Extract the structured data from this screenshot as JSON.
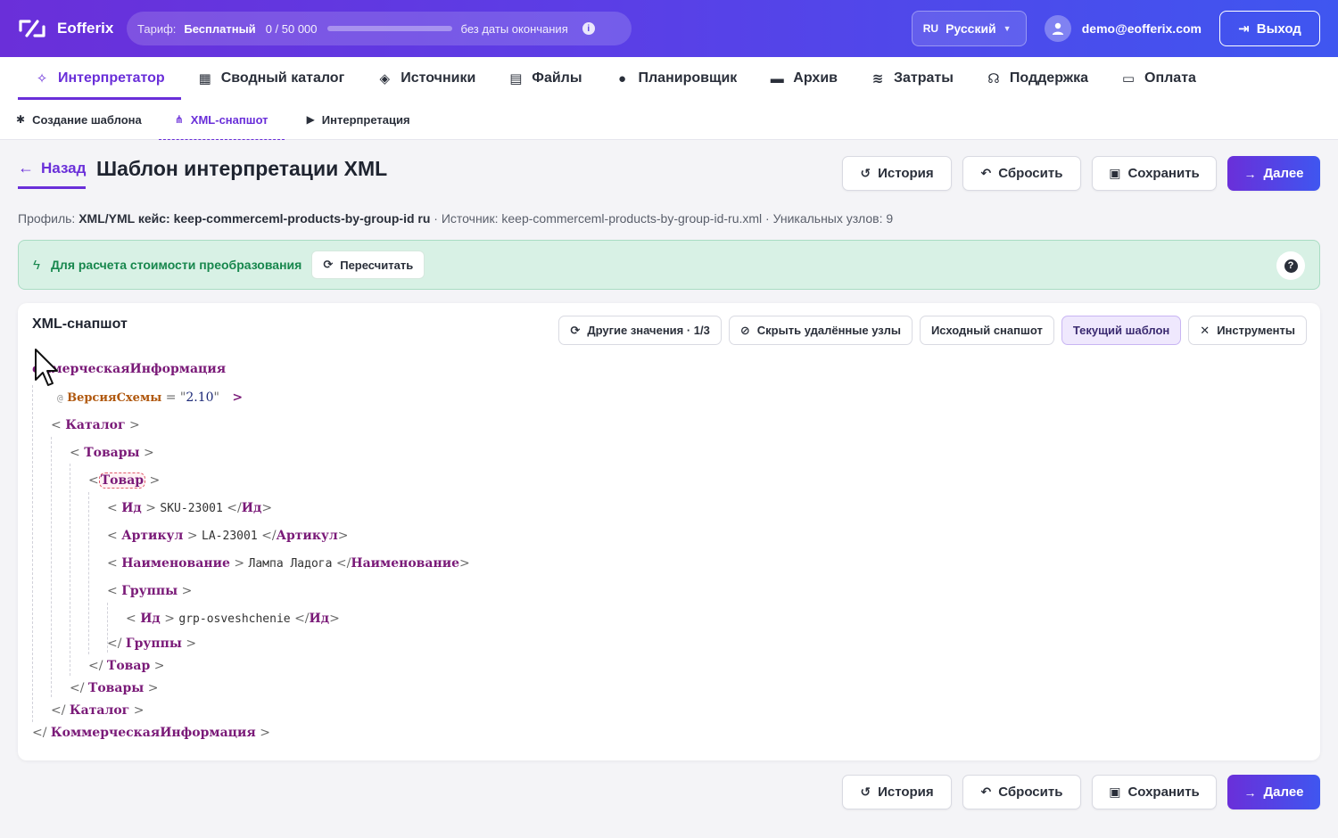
{
  "brand": {
    "name": "Eofferix"
  },
  "plan": {
    "label": "Тариф:",
    "name": "Бесплатный",
    "usage": "0 / 50 000",
    "usage_fraction": 0.0,
    "end": "без даты окончания"
  },
  "lang": {
    "code": "RU",
    "name": "Русский"
  },
  "user": {
    "email": "demo@eofferix.com"
  },
  "logout_label": "Выход",
  "mainnav": [
    {
      "label": "Интерпретатор",
      "icon": "wand-icon"
    },
    {
      "label": "Сводный каталог",
      "icon": "boxes-icon"
    },
    {
      "label": "Источники",
      "icon": "layers-icon"
    },
    {
      "label": "Файлы",
      "icon": "files-icon"
    },
    {
      "label": "Планировщик",
      "icon": "clock-icon"
    },
    {
      "label": "Архив",
      "icon": "archive-icon"
    },
    {
      "label": "Затраты",
      "icon": "coins-icon"
    },
    {
      "label": "Поддержка",
      "icon": "headset-icon"
    },
    {
      "label": "Оплата",
      "icon": "card-icon"
    }
  ],
  "subnav": [
    {
      "label": "Создание шаблона",
      "icon": "gear-icon"
    },
    {
      "label": "XML-снапшот",
      "icon": "sitemap-icon"
    },
    {
      "label": "Интерпретация",
      "icon": "play-icon"
    }
  ],
  "page": {
    "back": "Назад",
    "title": "Шаблон интерпретации XML",
    "profile_label": "Профиль:",
    "profile_name": "XML/YML кейс: keep-commerceml-products-by-group-id ru",
    "source": "· Источник: keep-commerceml-products-by-group-id-ru.xml · Уникальных узлов: 9"
  },
  "actions": {
    "history": "История",
    "reset": "Сбросить",
    "save": "Сохранить",
    "next": "Далее"
  },
  "notice": {
    "text": "Для расчета стоимости преобразования",
    "recalc": "Пересчитать",
    "help": "?"
  },
  "card": {
    "title": "XML-снапшот",
    "tools": {
      "other_values": "Другие значения · 1/3",
      "hide_deleted": "Скрыть удалённые узлы",
      "source_snapshot": "Исходный снапшот",
      "current_template": "Текущий шаблон",
      "instruments": "Инструменты"
    }
  },
  "xml": {
    "root": "КоммерческаяИнформация",
    "root_open_visible": "оммерческаяИнформация",
    "attr_name": "ВерсияСхемы",
    "attr_value": "2.10",
    "catalog": "Каталог",
    "goods": "Товары",
    "item": "Товар",
    "id_tag": "Ид",
    "id_value": "SKU-23001",
    "article_tag": "Артикул",
    "article_value": "LA-23001",
    "name_tag": "Наименование",
    "name_value": "Лампа Ладога",
    "groups_tag": "Группы",
    "group_id_value": "grp-osveshchenie"
  }
}
